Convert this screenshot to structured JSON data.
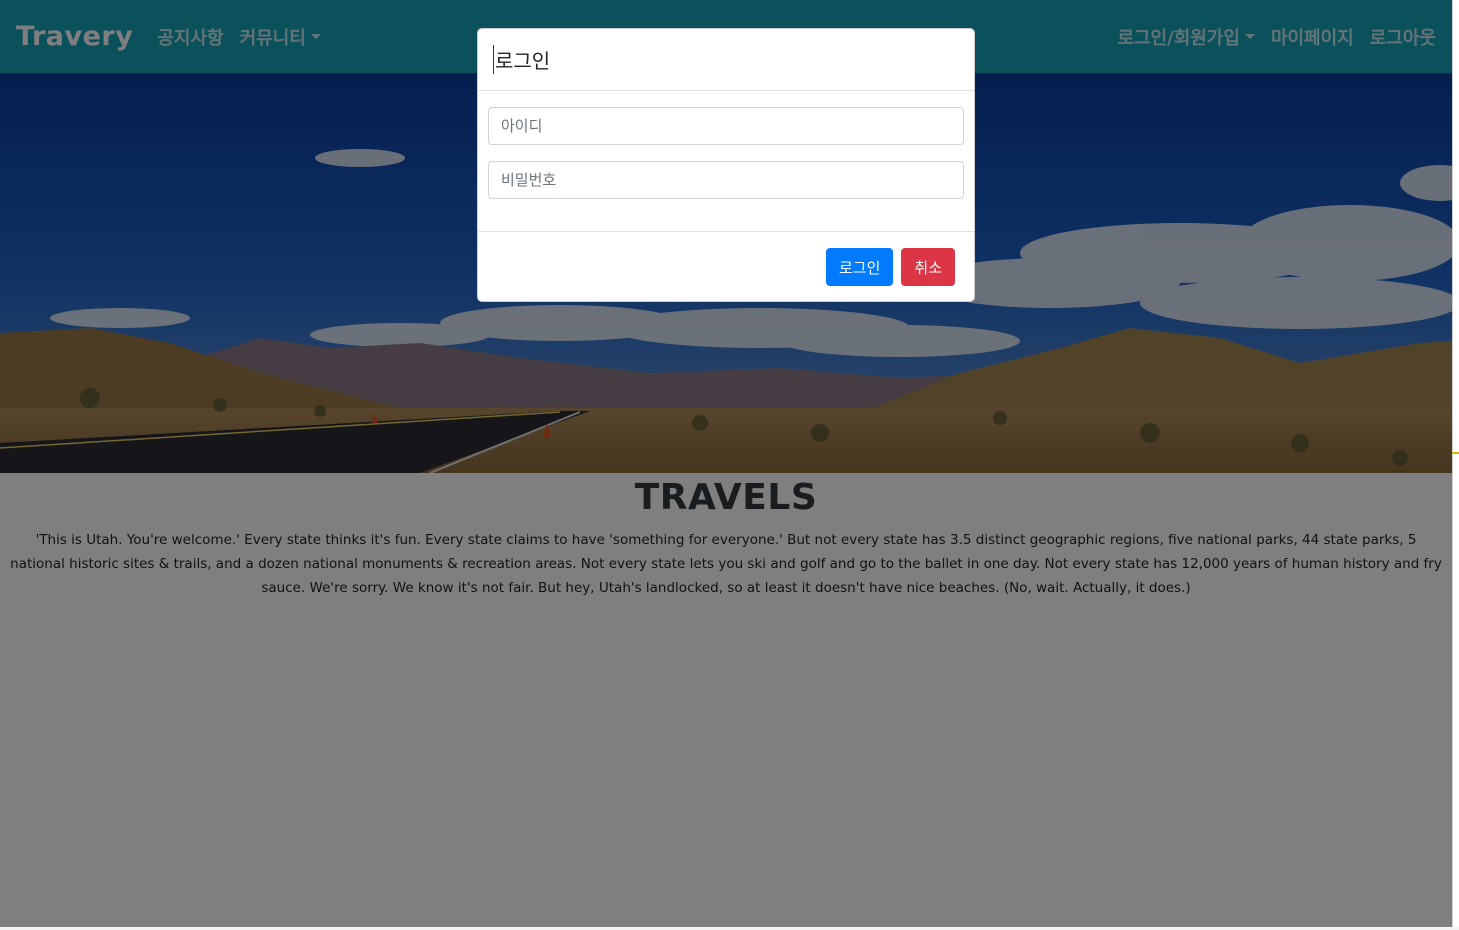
{
  "navbar": {
    "brand": "Travery",
    "left_items": [
      {
        "label": "공지사항",
        "dropdown": false
      },
      {
        "label": "커뮤니티",
        "dropdown": true
      }
    ],
    "right_items": [
      {
        "label": "로그인/회원가입",
        "dropdown": true
      },
      {
        "label": "마이페이지",
        "dropdown": false
      },
      {
        "label": "로그아웃",
        "dropdown": false
      }
    ]
  },
  "main": {
    "title": "TRAVELS",
    "text": "'This is Utah. You're welcome.' Every state thinks it's fun. Every state claims to have 'something for everyone.' But not every state has 3.5 distinct geographic regions, five national parks, 44 state parks, 5 national historic sites & trails, and a dozen national monuments & recreation areas. Not every state lets you ski and golf and go to the ballet in one day. Not every state has 12,000 years of human history and fry sauce. We're sorry. We know it's not fair. But hey, Utah's landlocked, so at least it doesn't have nice beaches. (No, wait. Actually, it does.)"
  },
  "modal": {
    "title": "로그인",
    "id_placeholder": "아이디",
    "password_placeholder": "비밀번호",
    "login_button": "로그인",
    "cancel_button": "취소"
  },
  "colors": {
    "navbar": "#17a2b8",
    "primary": "#007bff",
    "danger": "#dc3545"
  }
}
